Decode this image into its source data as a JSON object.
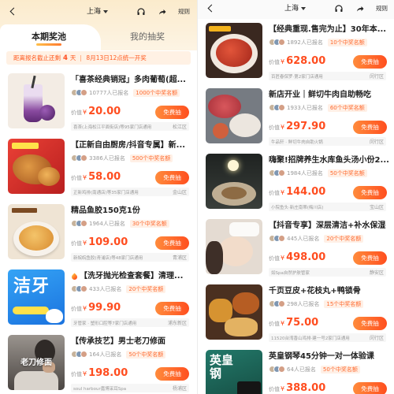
{
  "labels": {
    "value": "价值",
    "currency": "¥",
    "free_draw": "免费抽"
  },
  "theme": {
    "accent": "#ff5a1f",
    "button_from": "#ff8b3c",
    "button_to": "#ff4f1f",
    "price": "#ff4d1f",
    "badge_bg": "#fff0e6"
  },
  "screens": [
    {
      "topbar": {
        "back_icon": "chevron-left-icon",
        "city": "上海",
        "city_icon": "caret-down-icon",
        "service_icon": "headphones-icon",
        "share_icon": "share-icon",
        "rules": "规则"
      },
      "tabs": [
        {
          "label": "本期奖池",
          "active": true
        },
        {
          "label": "我的抽奖",
          "active": false
        }
      ],
      "banner": {
        "prefix": "距离报名截止还剩",
        "days": "4",
        "unit": "天",
        "draw_time": "8月13日12点统一开奖"
      },
      "items": [
        {
          "title": "「喜茶经典销冠」多肉葡萄(超...",
          "participants": "10777人已报名",
          "quota": "1000个中奖名额",
          "price": "20.00",
          "stores": "喜茶(上海松江平面街店)等95家门店通用",
          "district": "松江区"
        },
        {
          "title": "【正新自由厨房/抖音专属】新...",
          "participants": "3386人已报名",
          "quota": "500个中奖名额",
          "price": "58.00",
          "stores": "正新鸡排(南通店)等35家门店通用",
          "district": "金山区"
        },
        {
          "title": "精品鱼胶150克1份",
          "participants": "1964人已报名",
          "quota": "30个中奖名额",
          "price": "109.00",
          "stores": "新皖皖鱼胶(青浦店)等48家门店通用",
          "district": "青浦区"
        },
        {
          "title_icon": "fire-icon",
          "title": "【洗牙抛光检查套餐】清理...",
          "participants": "433人已报名",
          "quota": "20个中奖名额",
          "price": "99.90",
          "stores": "牙管家 · 塑形口腔等7家门店通用",
          "district": "浦东新区",
          "image_text": "洁牙"
        },
        {
          "title": "【传承技艺】男士老刀修面",
          "participants": "164人已报名",
          "quota": "50个中奖名额",
          "price": "198.00",
          "stores": "soul harbour嘉博采耳Spa",
          "district": "杨浦区",
          "image_text": "老刀修面"
        }
      ]
    },
    {
      "topbar": {
        "back_icon": "chevron-left-icon",
        "city": "上海",
        "city_icon": "caret-down-icon",
        "service_icon": "headphones-icon",
        "share_icon": "share-icon",
        "rules": "规则"
      },
      "items": [
        {
          "title": "【经典重现.售完为止】30年本...",
          "participants": "1892人已报名",
          "quota": "10个中奖名额",
          "price": "628.00",
          "stores": "百匠春保罗·第2家门店通用",
          "district": "闵行区"
        },
        {
          "title": "新店开业｜鲜切牛肉自助畅吃",
          "participants": "1933人已报名",
          "quota": "60个中奖名额",
          "price": "297.90",
          "stores": "牛品轩 · 鲜切牛肉自助火锅",
          "district": "闵行区"
        },
        {
          "title": "嗨聚!招牌养生水库鱼头汤小份2...",
          "participants": "1984人已报名",
          "quota": "50个中奖名额",
          "price": "144.00",
          "stores": "小院鱼头·新庄南蒂(梅川店)",
          "district": "宝山区"
        },
        {
          "title": "【抖音专享】深层清洁+补水保湿",
          "participants": "445人已报名",
          "quota": "20个中奖名额",
          "price": "498.00",
          "stores": "如Spa自然护肤管家",
          "district": "静安区"
        },
        {
          "title": "千页豆皮+花枝丸+鸭锁骨",
          "participants": "298人已报名",
          "quota": "15个中奖名额",
          "price": "75.00",
          "stores": "11520台湾香山鸡排·建一号2家门店通用",
          "district": "闵行区"
        },
        {
          "title": "英皇钢琴45分钟一对一体验课",
          "participants": "64人已报名",
          "quota": "50个中奖名额",
          "price": "388.00",
          "image_text": "英皇钢"
        }
      ]
    }
  ]
}
